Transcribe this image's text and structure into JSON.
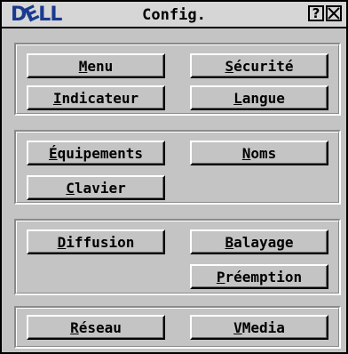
{
  "window": {
    "logo": {
      "pre": "D",
      "accent": "E",
      "post": "LL"
    },
    "title": "Config.",
    "help_label": "?",
    "logo_color": "#1a3a8f"
  },
  "groups": [
    {
      "buttons": [
        {
          "pre": "",
          "u": "M",
          "post": "enu"
        },
        {
          "pre": "",
          "u": "S",
          "post": "écurité"
        },
        {
          "pre": "",
          "u": "I",
          "post": "ndicateur"
        },
        {
          "pre": "",
          "u": "L",
          "post": "angue"
        }
      ]
    },
    {
      "buttons": [
        {
          "pre": "",
          "u": "É",
          "post": "quipements"
        },
        {
          "pre": "",
          "u": "N",
          "post": "oms"
        },
        {
          "pre": "",
          "u": "C",
          "post": "lavier"
        }
      ]
    },
    {
      "buttons": [
        {
          "pre": "",
          "u": "D",
          "post": "iffusion"
        },
        {
          "pre": "",
          "u": "B",
          "post": "alayage"
        },
        {
          "pre": "",
          "u": "P",
          "post": "réemption"
        }
      ]
    },
    {
      "buttons": [
        {
          "pre": "",
          "u": "R",
          "post": "éseau"
        },
        {
          "pre": "",
          "u": "V",
          "post": "Media"
        }
      ]
    }
  ]
}
